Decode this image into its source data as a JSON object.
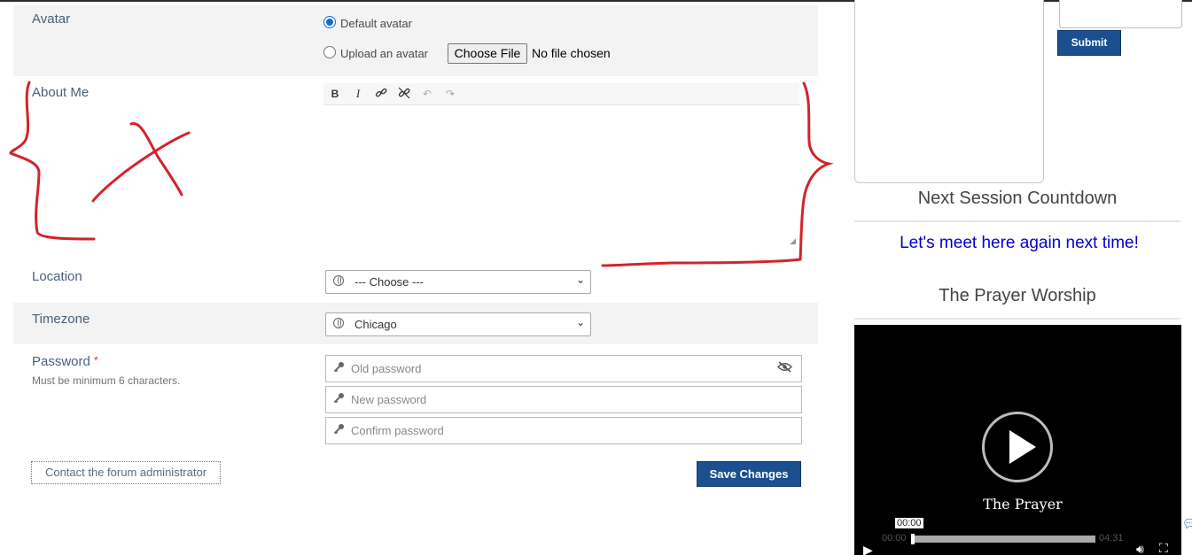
{
  "form": {
    "avatar": {
      "label": "Avatar",
      "option_default": "Default avatar",
      "option_upload": "Upload an avatar",
      "file_button": "Choose File",
      "file_status": "No file chosen",
      "selected": "default"
    },
    "about": {
      "label": "About Me",
      "toolbar": [
        "bold-icon",
        "italic-icon",
        "link-icon",
        "unlink-icon",
        "undo-icon",
        "redo-icon"
      ],
      "value": ""
    },
    "location": {
      "label": "Location",
      "selected": "--- Choose ---"
    },
    "timezone": {
      "label": "Timezone",
      "selected": "Chicago"
    },
    "password": {
      "label": "Password",
      "required_mark": "*",
      "hint": "Must be minimum 6 characters.",
      "old_placeholder": "Old password",
      "new_placeholder": "New password",
      "confirm_placeholder": "Confirm password"
    },
    "contact_button": "Contact the forum administrator",
    "save_button": "Save Changes"
  },
  "sidebar": {
    "submit_button": "Submit",
    "countdown_title": "Next Session Countdown",
    "meet_message": "Let's meet here again next time!",
    "worship_title": "The Prayer Worship",
    "video": {
      "title": "The Prayer",
      "hover_time": "00:00",
      "current_time": "00:00",
      "duration": "04:31",
      "progress_fraction": 0.0
    }
  },
  "colors": {
    "primary_button": "#1b4f8f",
    "link": "#0000cc",
    "annotation": "#d3232b"
  }
}
